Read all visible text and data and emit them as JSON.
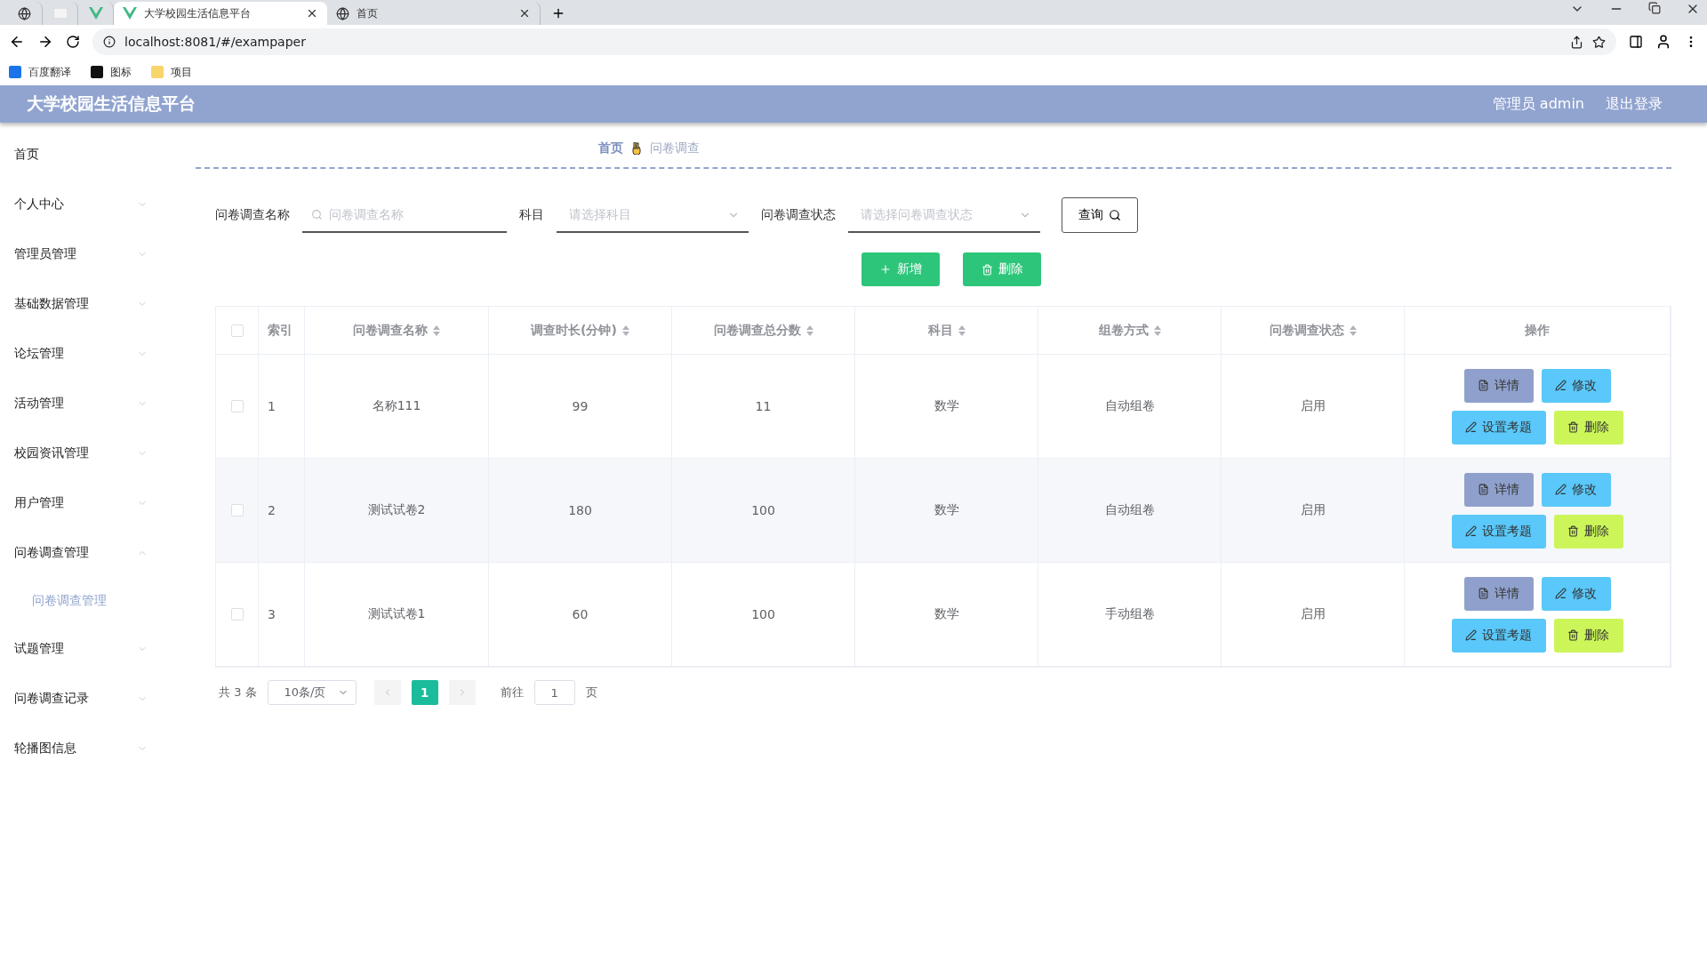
{
  "browser": {
    "tabs": [
      {
        "kind": "pinned",
        "selected": false
      },
      {
        "kind": "pinned",
        "selected": false
      },
      {
        "kind": "pinned",
        "selected": false
      },
      {
        "kind": "tab",
        "label": "大学校园生活信息平台",
        "selected": true
      },
      {
        "kind": "tab",
        "label": "首页",
        "selected": false
      }
    ],
    "url": "localhost:8081/#/exampaper",
    "bookmarks": [
      {
        "label": "百度翻译"
      },
      {
        "label": "图标"
      },
      {
        "label": "项目"
      }
    ]
  },
  "header": {
    "title": "大学校园生活信息平台",
    "user": "管理员 admin",
    "logout": "退出登录"
  },
  "sidebar": {
    "items": [
      {
        "label": "首页",
        "kind": "link"
      },
      {
        "label": "个人中心",
        "kind": "menu",
        "expanded": false
      },
      {
        "label": "管理员管理",
        "kind": "menu",
        "expanded": false
      },
      {
        "label": "基础数据管理",
        "kind": "menu",
        "expanded": false
      },
      {
        "label": "论坛管理",
        "kind": "menu",
        "expanded": false
      },
      {
        "label": "活动管理",
        "kind": "menu",
        "expanded": false
      },
      {
        "label": "校园资讯管理",
        "kind": "menu",
        "expanded": false
      },
      {
        "label": "用户管理",
        "kind": "menu",
        "expanded": false
      },
      {
        "label": "问卷调查管理",
        "kind": "menu",
        "expanded": true,
        "children": [
          {
            "label": "问卷调查管理",
            "selected": true
          }
        ]
      },
      {
        "label": "试题管理",
        "kind": "menu",
        "expanded": false
      },
      {
        "label": "问卷调查记录",
        "kind": "menu",
        "expanded": false
      },
      {
        "label": "轮播图信息",
        "kind": "menu",
        "expanded": false
      }
    ]
  },
  "breadcrumb": [
    "首页",
    "问卷调查"
  ],
  "filters": [
    {
      "kind": "input",
      "label": "问卷调查名称",
      "placeholder": "问卷调查名称"
    },
    {
      "kind": "select",
      "label": "科目",
      "placeholder": "请选择科目"
    },
    {
      "kind": "select",
      "label": "问卷调查状态",
      "placeholder": "请选择问卷调查状态"
    }
  ],
  "search_button": "查询",
  "actions": [
    {
      "kind": "add",
      "label": "新增"
    },
    {
      "kind": "delete",
      "label": "删除"
    }
  ],
  "table": {
    "select_all": {
      "checked": false
    },
    "columns": [
      {
        "label": "索引",
        "sortable": false
      },
      {
        "label": "问卷调查名称",
        "sortable": true
      },
      {
        "label": "调查时长(分钟)",
        "sortable": true
      },
      {
        "label": "问卷调查总分数",
        "sortable": true
      },
      {
        "label": "科目",
        "sortable": true
      },
      {
        "label": "组卷方式",
        "sortable": true
      },
      {
        "label": "问卷调查状态",
        "sortable": true
      },
      {
        "label": "操作",
        "sortable": false
      }
    ],
    "rows": [
      {
        "checked": false,
        "cells": [
          "1",
          "名称111",
          "99",
          "11",
          "数学",
          "自动组卷",
          "启用"
        ],
        "actions": [
          {
            "kind": "detail",
            "label": "详情"
          },
          {
            "kind": "edit",
            "label": "修改"
          },
          {
            "kind": "setup",
            "label": "设置考题"
          },
          {
            "kind": "delete",
            "label": "删除"
          }
        ]
      },
      {
        "checked": false,
        "cells": [
          "2",
          "测试试卷2",
          "180",
          "100",
          "数学",
          "自动组卷",
          "启用"
        ],
        "actions": [
          {
            "kind": "detail",
            "label": "详情"
          },
          {
            "kind": "edit",
            "label": "修改"
          },
          {
            "kind": "setup",
            "label": "设置考题"
          },
          {
            "kind": "delete",
            "label": "删除"
          }
        ]
      },
      {
        "checked": false,
        "cells": [
          "3",
          "测试试卷1",
          "60",
          "100",
          "数学",
          "手动组卷",
          "启用"
        ],
        "actions": [
          {
            "kind": "detail",
            "label": "详情"
          },
          {
            "kind": "edit",
            "label": "修改"
          },
          {
            "kind": "setup",
            "label": "设置考题"
          },
          {
            "kind": "delete",
            "label": "删除"
          }
        ]
      }
    ]
  },
  "pagination": {
    "total": "共 3 条",
    "page_size": "10条/页",
    "pages": [
      {
        "label": "1",
        "selected": true
      }
    ],
    "goto_label": "前往",
    "goto_value": "1",
    "goto_suffix": "页"
  }
}
